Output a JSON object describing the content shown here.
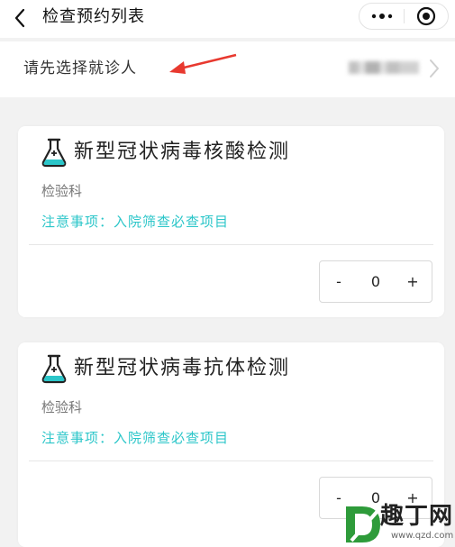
{
  "nav": {
    "title": "检查预约列表",
    "more_icon": "more-dots-icon",
    "close_icon": "target-close-icon"
  },
  "patient": {
    "label": "请先选择就诊人",
    "value": "blurred-patient-name"
  },
  "items": [
    {
      "title": "新型冠状病毒核酸检测",
      "department": "检验科",
      "note": "注意事项：入院筛查必查项目",
      "quantity": "0",
      "minus": "-",
      "plus": "+"
    },
    {
      "title": "新型冠状病毒抗体检测",
      "department": "检验科",
      "note": "注意事项：入院筛查必查项目",
      "quantity": "0",
      "minus": "-",
      "plus": "+"
    }
  ],
  "watermark": {
    "text": "趣丁网",
    "url": "www.qzd.com"
  },
  "colors": {
    "accent": "#2bc6c9",
    "arrow": "#e8392f",
    "background": "#f2f2f2"
  }
}
